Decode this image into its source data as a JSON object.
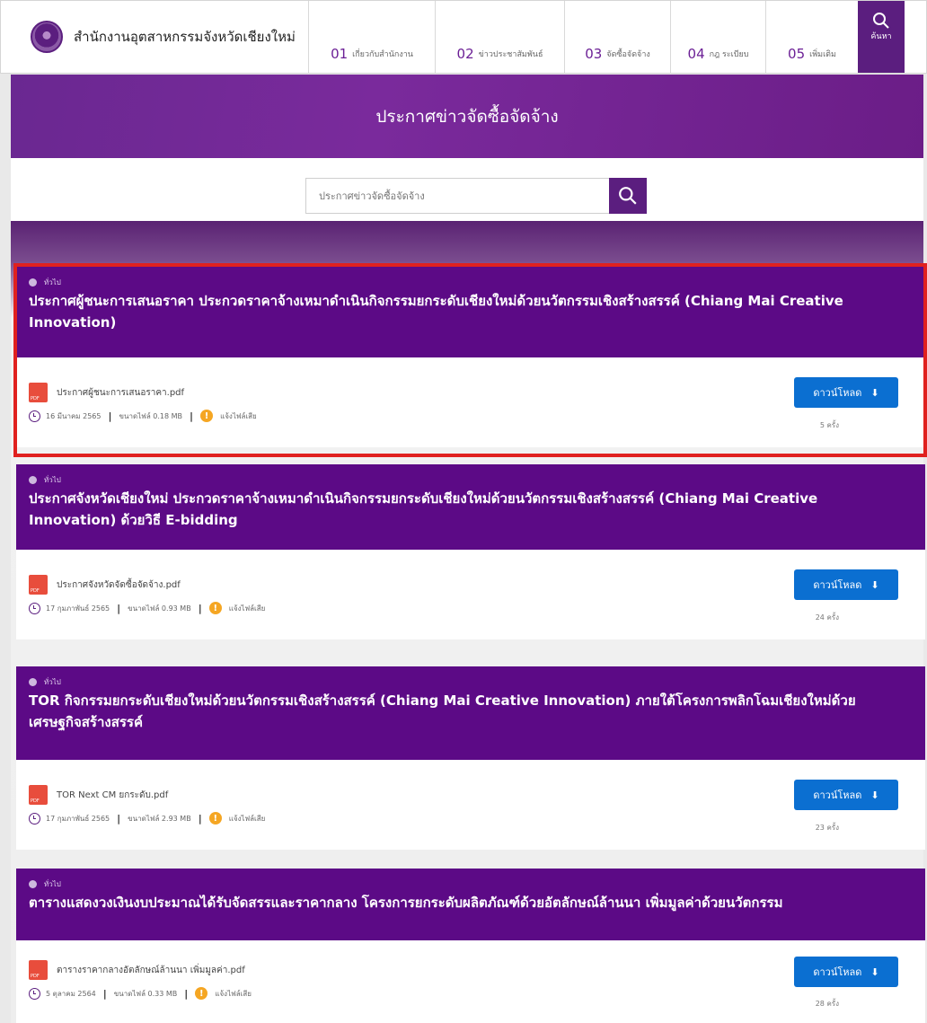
{
  "header": {
    "site_name": "สำนักงานอุตสาหกรรมจังหวัดเชียงใหม่",
    "nav": [
      {
        "num": "01",
        "label": "เกี่ยวกับสำนักงาน"
      },
      {
        "num": "02",
        "label": "ข่าวประชาสัมพันธ์"
      },
      {
        "num": "03",
        "label": "จัดซื้อจัดจ้าง"
      },
      {
        "num": "04",
        "label": "กฎ ระเบียบ"
      },
      {
        "num": "05",
        "label": "เพิ่มเติม"
      }
    ],
    "search_label": "ค้นหา"
  },
  "hero": {
    "title": "ประกาศข่าวจัดซื้อจัดจ้าง"
  },
  "search": {
    "placeholder": "ประกาศข่าวจัดซื้อจัดจ้าง"
  },
  "items": [
    {
      "tag": "ทั่วไป",
      "title": "ประกาศผู้ชนะการเสนอราคา ประกวดราคาจ้างเหมาดำเนินกิจกรรมยกระดับเชียงใหม่ด้วยนวัตกรรมเชิงสร้างสรรค์ (Chiang Mai Creative Innovation)",
      "file_name": "ประกาศผู้ชนะการเสนอราคา.pdf",
      "date": "16 มีนาคม 2565",
      "size": "ขนาดไฟล์ 0.18 MB",
      "report": "แจ้งไฟล์เสีย",
      "download_label": "ดาวน์โหลด",
      "count": "5 ครั้ง"
    },
    {
      "tag": "ทั่วไป",
      "title": "ประกาศจังหวัดเชียงใหม่ ประกวดราคาจ้างเหมาดำเนินกิจกรรมยกระดับเชียงใหม่ด้วยนวัตกรรมเชิงสร้างสรรค์ (Chiang Mai Creative Innovation) ด้วยวิธี E-bidding",
      "file_name": "ประกาศจังหวัดจัดซื้อจัดจ้าง.pdf",
      "date": "17 กุมภาพันธ์ 2565",
      "size": "ขนาดไฟล์ 0.93 MB",
      "report": "แจ้งไฟล์เสีย",
      "download_label": "ดาวน์โหลด",
      "count": "24 ครั้ง"
    },
    {
      "tag": "ทั่วไป",
      "title": "TOR กิจกรรมยกระดับเชียงใหม่ด้วยนวัตกรรมเชิงสร้างสรรค์ (Chiang Mai Creative Innovation) ภายใต้โครงการพลิกโฉมเชียงใหม่ด้วยเศรษฐกิจสร้างสรรค์",
      "file_name": "TOR Next CM ยกระดับ.pdf",
      "date": "17 กุมภาพันธ์ 2565",
      "size": "ขนาดไฟล์ 2.93 MB",
      "report": "แจ้งไฟล์เสีย",
      "download_label": "ดาวน์โหลด",
      "count": "23 ครั้ง"
    },
    {
      "tag": "ทั่วไป",
      "title": "ตารางแสดงวงเงินงบประมาณได้รับจัดสรรและราคากลาง โครงการยกระดับผลิตภัณฑ์ด้วยอัตลักษณ์ล้านนา เพิ่มมูลค่าด้วยนวัตกรรม",
      "file_name": "ตารางราคากลางอัตลักษณ์ล้านนา เพิ่มมูลค่า.pdf",
      "date": "5 ตุลาคม 2564",
      "size": "ขนาดไฟล์ 0.33 MB",
      "report": "แจ้งไฟล์เสีย",
      "download_label": "ดาวน์โหลด",
      "count": "28 ครั้ง"
    }
  ],
  "colors": {
    "brand": "#5c0a86",
    "download": "#0b6fd1",
    "highlight": "#e0211f",
    "warn": "#f5a623"
  }
}
